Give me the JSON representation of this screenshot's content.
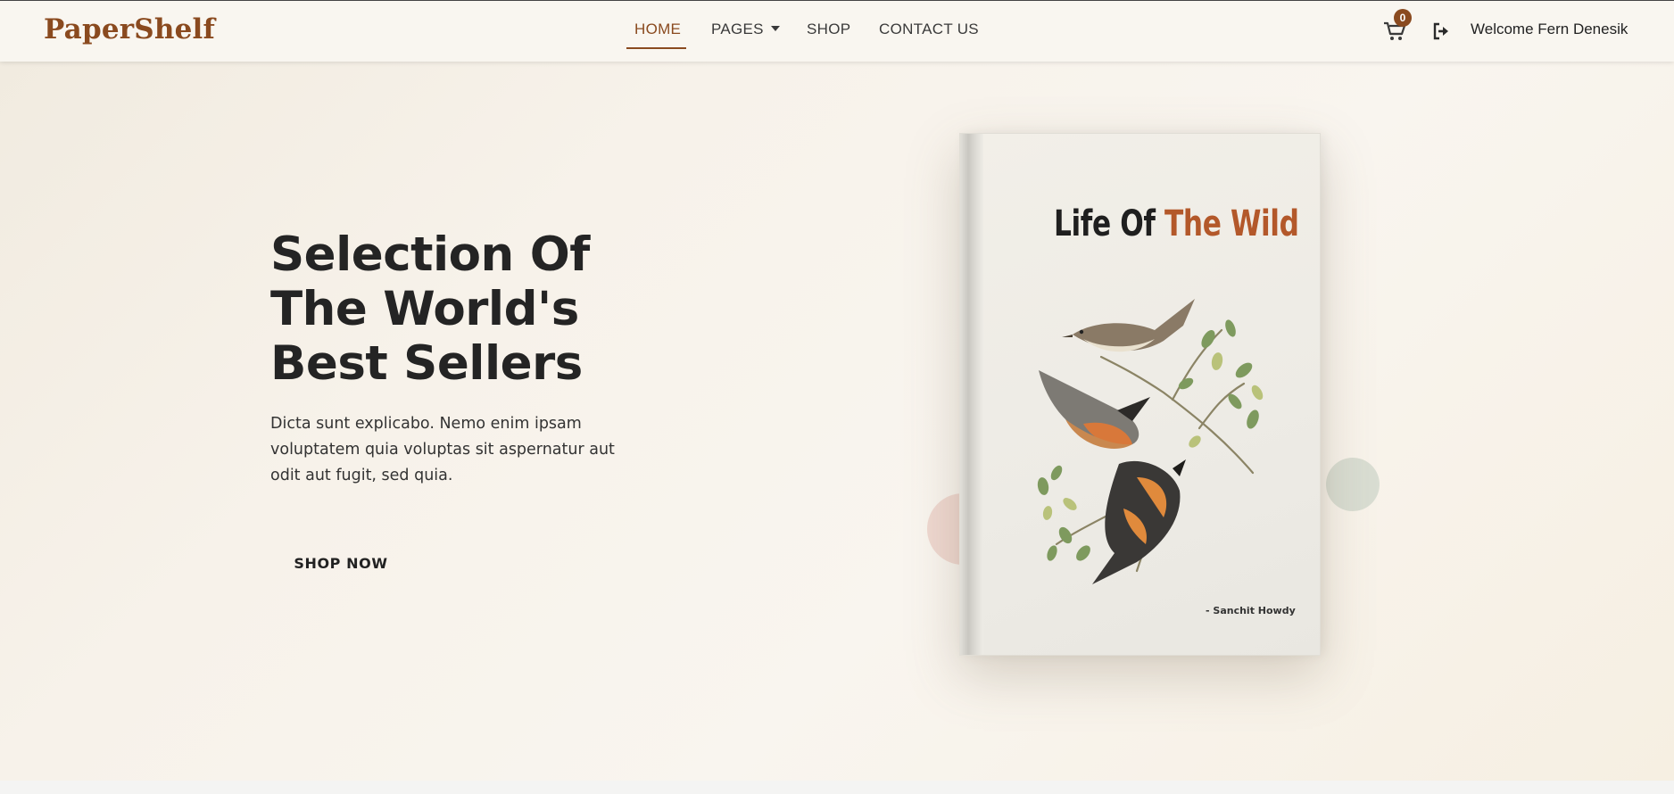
{
  "header": {
    "brand": "PaperShelf",
    "nav": [
      {
        "label": "HOME",
        "active": true
      },
      {
        "label": "PAGES",
        "has_dropdown": true
      },
      {
        "label": "SHOP"
      },
      {
        "label": "CONTACT US"
      }
    ],
    "cart_icon": "cart-icon",
    "cart_count": "0",
    "logout_icon": "sign-out-icon",
    "welcome": "Welcome Fern Denesik"
  },
  "hero": {
    "headline": "Selection Of The World's Best Sellers",
    "subtext": "Dicta sunt explicabo. Nemo enim ipsam voluptatem quia voluptas sit aspernatur aut odit aut fugit, sed quia.",
    "cta_label": "SHOP NOW"
  },
  "book": {
    "title_part1": "Life Of ",
    "title_part2": "The Wild",
    "author": "- Sanchit Howdy"
  },
  "colors": {
    "brand": "#8a4a1f",
    "text_dark": "#242424",
    "book_accent": "#b3582a"
  }
}
